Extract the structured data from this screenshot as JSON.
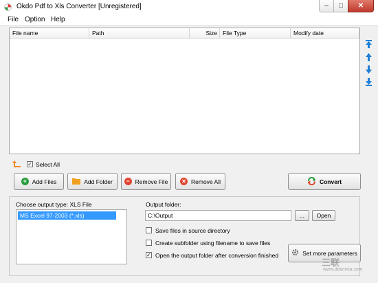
{
  "window": {
    "title": "Okdo Pdf to Xls Converter [Unregistered]",
    "minimize_glyph": "–",
    "maximize_glyph": "□",
    "close_glyph": "✕"
  },
  "menu": [
    "File",
    "Option",
    "Help"
  ],
  "file_list": {
    "columns": [
      "File name",
      "Path",
      "Size",
      "File Type",
      "Modify date"
    ],
    "rows": []
  },
  "side_buttons": [
    "move-top-icon",
    "move-up-icon",
    "move-down-icon",
    "move-bottom-icon"
  ],
  "select_all": {
    "label": "Select All",
    "checked": true
  },
  "buttons": {
    "add_files": "Add Files",
    "add_folder": "Add Folder",
    "remove_file": "Remove File",
    "remove_all": "Remove All",
    "convert": "Convert"
  },
  "output": {
    "type_label": "Choose output type:  XLS File",
    "types": [
      "MS Excel 97-2003 (*.xls)"
    ],
    "folder_label": "Output folder:",
    "folder_value": "C:\\Output",
    "browse_label": "...",
    "open_label": "Open",
    "options": [
      {
        "label": "Save files in source directory",
        "checked": false
      },
      {
        "label": "Create subfolder using filename to save files",
        "checked": false
      },
      {
        "label": "Open the output folder after conversion finished",
        "checked": true
      }
    ],
    "more_params_label": "Set more parameters"
  },
  "watermark": {
    "text": "三联",
    "sub": "www.downxia.com"
  },
  "colors": {
    "accent_blue": "#1e7fd8",
    "selection": "#3399ff",
    "convert_green": "#2a9d3c",
    "close_red": "#c0392b"
  }
}
